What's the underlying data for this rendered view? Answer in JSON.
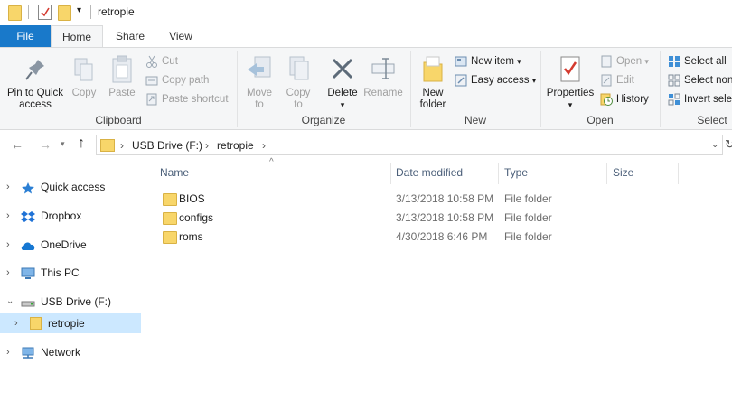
{
  "window": {
    "title": "retropie"
  },
  "tabs": {
    "file": "File",
    "home": "Home",
    "share": "Share",
    "view": "View"
  },
  "ribbon": {
    "clipboard": {
      "label": "Clipboard",
      "pin_line1": "Pin to Quick",
      "pin_line2": "access",
      "copy": "Copy",
      "paste": "Paste",
      "cut": "Cut",
      "copy_path": "Copy path",
      "paste_shortcut": "Paste shortcut"
    },
    "organize": {
      "label": "Organize",
      "move_to": "Move",
      "move_to2": "to",
      "copy_to": "Copy",
      "copy_to2": "to",
      "delete": "Delete",
      "rename": "Rename"
    },
    "new": {
      "label": "New",
      "new_folder1": "New",
      "new_folder2": "folder",
      "new_item": "New item",
      "easy_access": "Easy access"
    },
    "open": {
      "label": "Open",
      "properties": "Properties",
      "open": "Open",
      "edit": "Edit",
      "history": "History"
    },
    "select": {
      "label": "Select",
      "select_all": "Select all",
      "select_none": "Select none",
      "invert": "Invert selection"
    }
  },
  "address": {
    "crumbs": [
      "USB Drive (F:)",
      "retropie"
    ]
  },
  "nav": {
    "items": [
      "Quick access",
      "Dropbox",
      "OneDrive",
      "This PC",
      "USB Drive (F:)",
      "retropie",
      "Network"
    ]
  },
  "columns": {
    "name": "Name",
    "date": "Date modified",
    "type": "Type",
    "size": "Size"
  },
  "files": [
    {
      "name": "BIOS",
      "date": "3/13/2018 10:58 PM",
      "type": "File folder"
    },
    {
      "name": "configs",
      "date": "3/13/2018 10:58 PM",
      "type": "File folder"
    },
    {
      "name": "roms",
      "date": "4/30/2018 6:46 PM",
      "type": "File folder"
    }
  ],
  "colors": {
    "accent": "#1979ca",
    "selection": "#cce8ff",
    "folder": "#f8d66a"
  }
}
